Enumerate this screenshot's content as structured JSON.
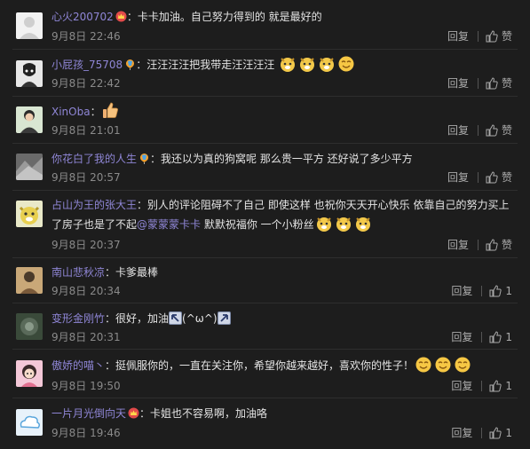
{
  "labels": {
    "reply": "回复",
    "like": "赞"
  },
  "comments": [
    {
      "user": "心火200702",
      "sep": "：",
      "text": "卡卡加油。自己努力得到的 就是最好的",
      "date": "9月8日",
      "time": "22:46",
      "reply": "回复",
      "like": "赞"
    },
    {
      "user": "小屁孩_75708",
      "sep": "：",
      "text": "汪汪汪汪把我带走汪汪汪汪",
      "date": "9月8日",
      "time": "22:42",
      "reply": "回复",
      "like": "赞"
    },
    {
      "user": "XinOba",
      "sep": "：",
      "text": "",
      "date": "9月8日",
      "time": "21:01",
      "reply": "回复",
      "like": "赞"
    },
    {
      "user": "你花白了我的人生",
      "sep": "：",
      "text": "我还以为真的狗窝呢 那么贵一平方 还好说了多少平方",
      "date": "9月8日",
      "time": "20:57",
      "reply": "回复",
      "like": "赞"
    },
    {
      "user": "占山为王的张大王",
      "sep": "：",
      "text_a": "别人的评论阻碍不了自己 即使这样 也祝你天天开心快乐 依靠自己的努力买上了房子也是了不起",
      "mention": "@蒙蒙蒙卡卡",
      "text_b": " 默默祝福你 一个小粉丝",
      "date": "9月8日",
      "time": "20:37",
      "reply": "回复",
      "like": "赞"
    },
    {
      "user": "南山悲秋凉",
      "sep": "：",
      "text": "卡爹最棒",
      "date": "9月8日",
      "time": "20:34",
      "reply": "回复",
      "like_count": "1"
    },
    {
      "user": "变形金刚竹",
      "sep": "：",
      "text_a": "很好，加油",
      "text_b": "(^ω^)",
      "date": "9月8日",
      "time": "20:31",
      "reply": "回复",
      "like_count": "1"
    },
    {
      "user": "傲娇的喵丶",
      "sep": "：",
      "text": "挺佩服你的，一直在关注你，希望你越来越好，喜欢你的性子！",
      "date": "9月8日",
      "time": "19:50",
      "reply": "回复",
      "like_count": "1"
    },
    {
      "user": "一片月光倒向天",
      "sep": "：",
      "text": "卡姐也不容易啊，加油咯",
      "date": "9月8日",
      "time": "19:46",
      "reply": "回复",
      "like_count": "1"
    }
  ]
}
